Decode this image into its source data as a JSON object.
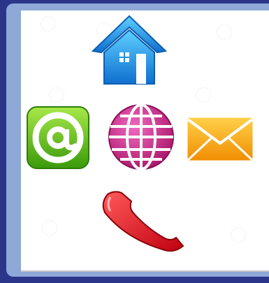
{
  "icons": [
    {
      "name": "home-icon",
      "color": "#1e90e0"
    },
    {
      "name": "email-at-icon",
      "color": "#5cb814"
    },
    {
      "name": "globe-icon",
      "color": "#d5338f"
    },
    {
      "name": "mail-envelope-icon",
      "color": "#f5a300"
    },
    {
      "name": "phone-handset-icon",
      "color": "#e0101a"
    }
  ],
  "colors": {
    "frame_outer": "#2b3589",
    "frame_inner": "#8ea9d8",
    "panel": "#ffffff"
  }
}
